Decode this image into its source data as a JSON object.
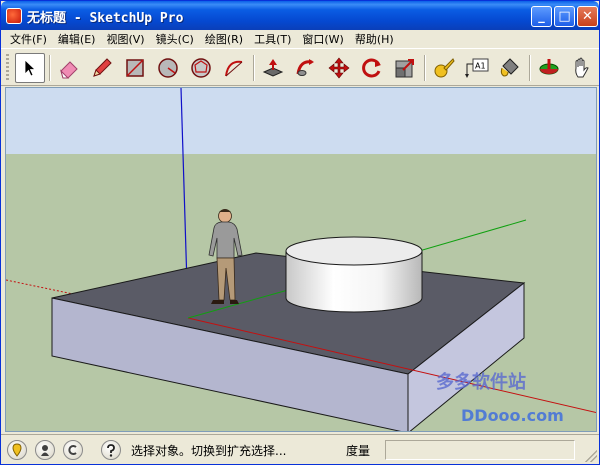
{
  "window": {
    "title": "无标题 - SketchUp Pro",
    "minimize_glyph": "_",
    "maximize_glyph": "□",
    "close_glyph": "✕"
  },
  "menu": {
    "items": [
      "文件(F)",
      "编辑(E)",
      "视图(V)",
      "镜头(C)",
      "绘图(R)",
      "工具(T)",
      "窗口(W)",
      "帮助(H)"
    ]
  },
  "toolbar": {
    "tools": [
      {
        "name": "select-tool",
        "icon": "arrow-icon",
        "active": true
      },
      {
        "name": "eraser-tool",
        "icon": "eraser-icon"
      },
      {
        "name": "pencil-tool",
        "icon": "pencil-icon"
      },
      {
        "name": "rectangle-tool",
        "icon": "rectangle-icon"
      },
      {
        "name": "circle-tool",
        "icon": "circle-icon"
      },
      {
        "name": "polygon-tool",
        "icon": "polygon-icon"
      },
      {
        "name": "arc-tool",
        "icon": "arc-icon"
      },
      {
        "name": "push-pull-tool",
        "icon": "push-pull-icon"
      },
      {
        "name": "follow-me-tool",
        "icon": "follow-me-icon"
      },
      {
        "name": "move-tool",
        "icon": "move-icon"
      },
      {
        "name": "rotate-tool",
        "icon": "rotate-icon"
      },
      {
        "name": "scale-tool",
        "icon": "scale-icon"
      },
      {
        "name": "tape-measure-tool",
        "icon": "tape-measure-icon"
      },
      {
        "name": "text-tool",
        "icon": "text-icon",
        "label": "A1"
      },
      {
        "name": "paint-bucket-tool",
        "icon": "paint-bucket-icon"
      },
      {
        "name": "orbit-tool",
        "icon": "orbit-icon"
      },
      {
        "name": "pan-tool",
        "icon": "hand-icon"
      }
    ]
  },
  "watermark": {
    "brand": "多多软件站",
    "site": "DDooo.com"
  },
  "statusbar": {
    "icons": [
      "geo-location-icon",
      "credits-icon",
      "copyright-icon",
      "help-icon"
    ],
    "message": "选择对象。切换到扩充选择...",
    "measure_label": "度量",
    "measure_value": ""
  },
  "colors": {
    "sky": "#cddcf0",
    "ground": "#b6c7a6",
    "slab_top": "#5a5b66",
    "slab_front": "#b4b6cf",
    "slab_side": "#c4c6de",
    "axis_red": "#c41010",
    "axis_green": "#10a010",
    "axis_blue": "#1010c8"
  }
}
